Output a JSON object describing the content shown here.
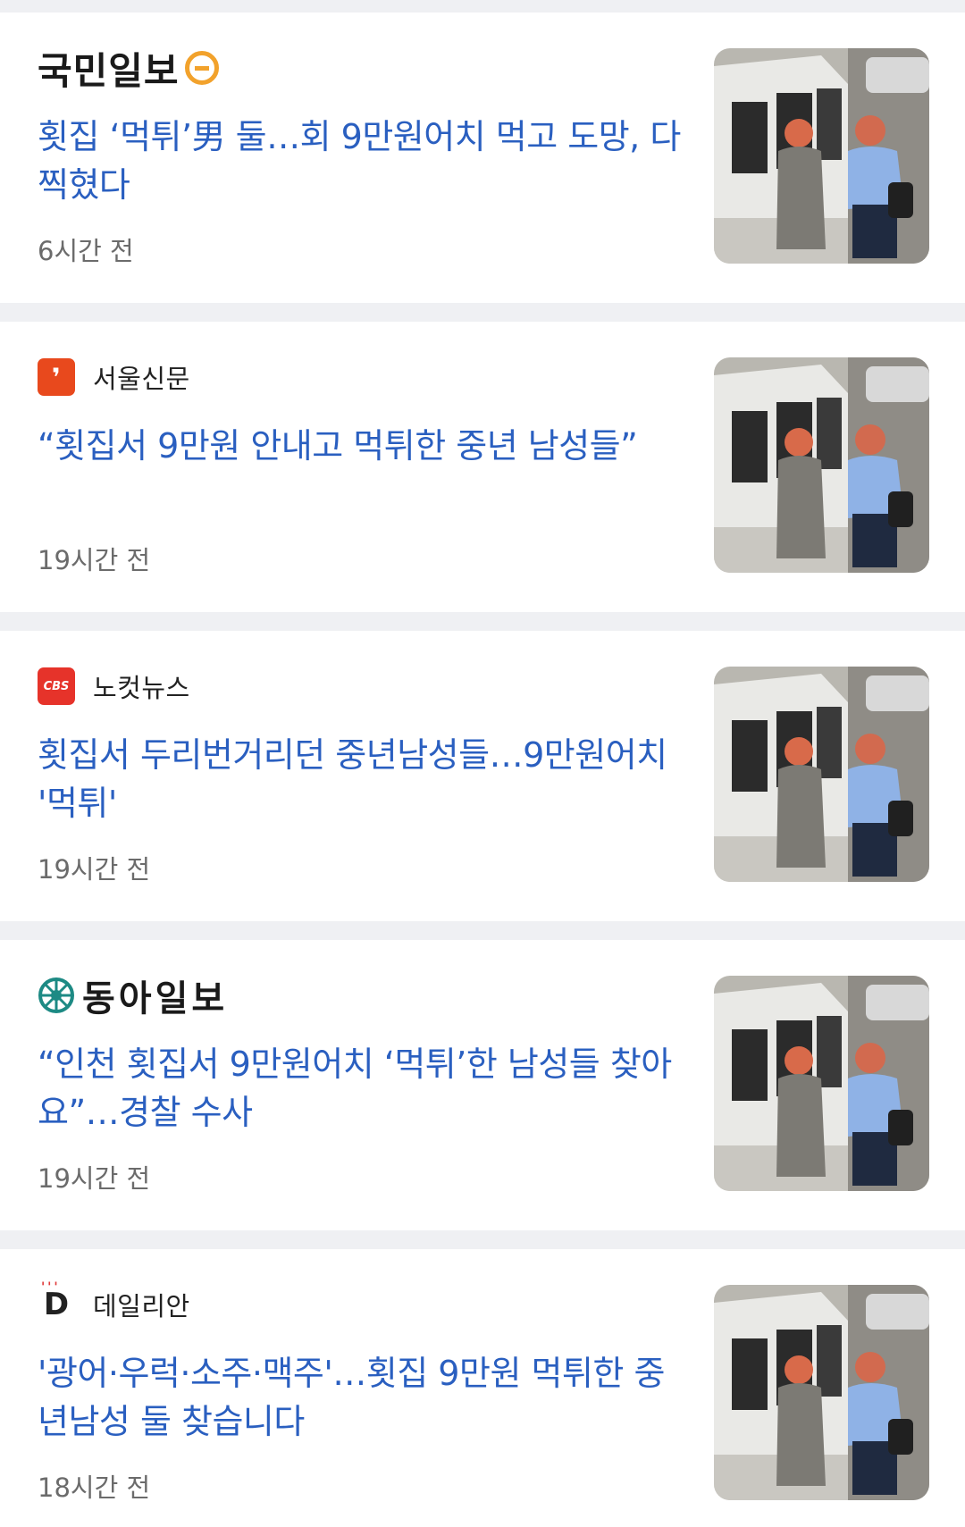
{
  "articles": [
    {
      "publisher": "국민일보",
      "publisher_logo": "kookmin-logo",
      "headline": "횟집 ‘먹튀’男 둘…회 9만원어치 먹고 도망, 다 찍혔다",
      "time": "6시간 전"
    },
    {
      "publisher": "서울신문",
      "publisher_logo": "seoul-logo",
      "headline": "“횟집서 9만원 안내고 먹튀한 중년 남성들”",
      "time": "19시간 전"
    },
    {
      "publisher": "노컷뉴스",
      "publisher_logo": "nocut-logo",
      "headline": "횟집서 두리번거리던 중년남성들…9만원어치 '먹튀'",
      "time": "19시간 전"
    },
    {
      "publisher": "동아일보",
      "publisher_logo": "donga-logo",
      "headline": "“인천 횟집서 9만원어치 ‘먹튀’한 남성들 찾아요”…경찰 수사",
      "time": "19시간 전"
    },
    {
      "publisher": "데일리안",
      "publisher_logo": "dailian-logo",
      "headline": "'광어·우럭·소주·맥주'…횟집 9만원 먹튀한 중년남성 둘 찾습니다",
      "time": "18시간 전"
    }
  ],
  "colors": {
    "headline": "#2a5fc0",
    "background": "#eff0f3",
    "card": "#ffffff",
    "time": "#6b6b6b"
  }
}
